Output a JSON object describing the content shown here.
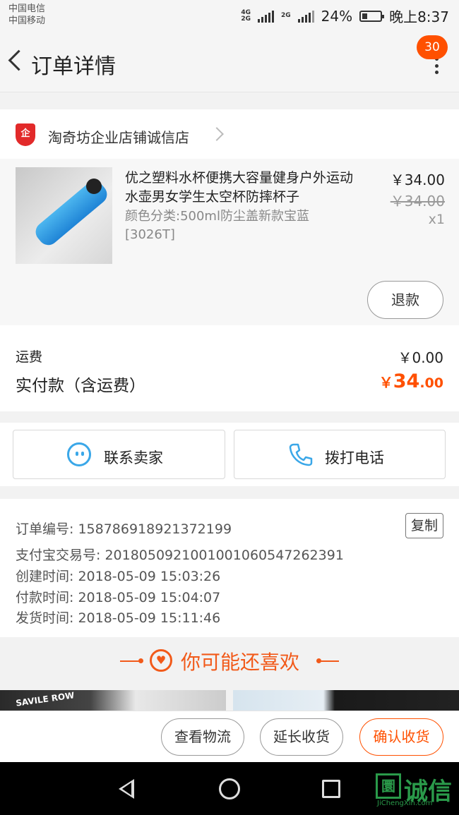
{
  "status_bar": {
    "carrier_1": "中国电信",
    "carrier_2": "中国移动",
    "battery": "24%",
    "time": "晚上8:37"
  },
  "nav": {
    "title": "订单详情",
    "badge": "30"
  },
  "shop": {
    "icon": "企",
    "name": "淘奇坊企业店铺诚信店"
  },
  "item": {
    "title": "优之塑料水杯便携大容量健身户外运动水壶男女学生太空杯防摔杯子",
    "sku": "颜色分类:500ml防尘盖新款宝蓝[3026T]",
    "price": "￥34.00",
    "original_price": "￥34.00",
    "quantity": "x1",
    "refund_label": "退款"
  },
  "payment": {
    "shipping_label": "运费",
    "shipping_value": "￥0.00",
    "total_label": "实付款（含运费）",
    "total_currency": "￥",
    "total_integer": "34",
    "total_decimal": ".00"
  },
  "contact": {
    "seller_label": "联系卖家",
    "phone_label": "拨打电话"
  },
  "order_info": {
    "order_no": "订单编号: 158786918921372199",
    "copy_label": "复制",
    "alipay_no": "支付宝交易号: 2018050921001001060547262391",
    "created": "创建时间: 2018-05-09 15:03:26",
    "paid": "付款时间: 2018-05-09 15:04:07",
    "shipped": "发货时间: 2018-05-09 15:11:46"
  },
  "recommend": {
    "title": "你可能还喜欢",
    "thumb1_text": "SAVILE ROW"
  },
  "actions": {
    "logistics": "查看物流",
    "extend": "延长收货",
    "confirm": "确认收货"
  },
  "watermark": {
    "box": "圜",
    "text": "诚信",
    "sub": "JiChengXin.com"
  },
  "colors": {
    "accent": "#ff5000",
    "recommend": "#f25a1a",
    "icon_blue": "#3aa7e8"
  }
}
